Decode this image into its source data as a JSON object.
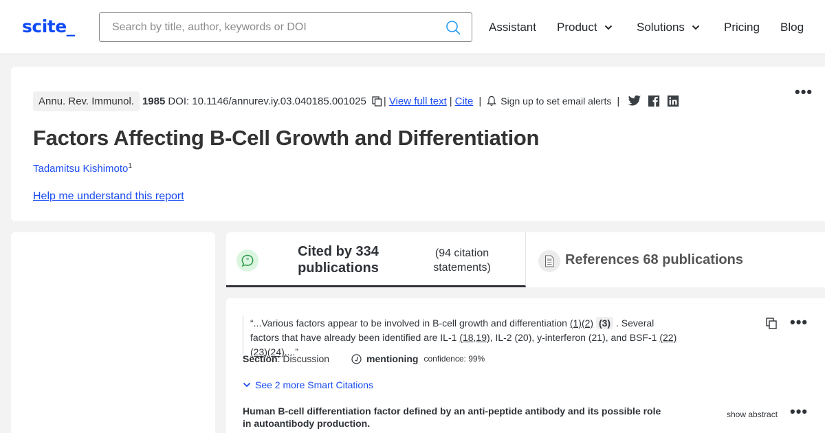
{
  "header": {
    "logo": "scite_",
    "search_placeholder": "Search by title, author, keywords or DOI",
    "search_value": "",
    "nav": [
      {
        "label": "Assistant",
        "has_dropdown": false
      },
      {
        "label": "Product",
        "has_dropdown": true
      },
      {
        "label": "Solutions",
        "has_dropdown": true
      },
      {
        "label": "Pricing",
        "has_dropdown": false
      },
      {
        "label": "Blog",
        "has_dropdown": false
      }
    ]
  },
  "paper": {
    "journal": "Annu. Rev. Immunol.",
    "year": "1985",
    "doi_label": "DOI:",
    "doi": "10.1146/annurev.iy.03.040185.001025",
    "separator": "|",
    "view_full_text": "View full text",
    "cite": "Cite",
    "email_alerts": "Sign up to set email alerts",
    "social": [
      "twitter-icon",
      "facebook-icon",
      "linkedin-icon"
    ],
    "more_menu": "•••",
    "title": "Factors Affecting B-Cell Growth and Differentiation",
    "author": "Tadamitsu Kishimoto",
    "author_affiliation": "1",
    "help_link": "Help me understand this report"
  },
  "tabs": {
    "cited": {
      "title": "Cited by 334 publications",
      "subtitle": "(94 citation statements)",
      "active": true
    },
    "references": {
      "title": "References 68 publications",
      "active": false
    }
  },
  "citation": {
    "quote_parts": [
      {
        "text": "“...Various factors appear to be involved in B-cell growth and differentiation ",
        "type": "text"
      },
      {
        "text": "(1)(2)",
        "type": "ref"
      },
      {
        "text": " ",
        "type": "text"
      },
      {
        "text": "(3)",
        "type": "highlight"
      },
      {
        "text": " . Several factors that have already been identified are IL-1 ",
        "type": "text"
      },
      {
        "text": "(18,19)",
        "type": "ref"
      },
      {
        "text": ", IL-2 (20), y-interferon (21), and BSF-1 ",
        "type": "text"
      },
      {
        "text": "(22)(23)(24)",
        "type": "ref"
      },
      {
        "text": "....”",
        "type": "text"
      }
    ],
    "section_label": "Section",
    "section_value": ": Discussion",
    "classification": "mentioning",
    "confidence": "confidence: 99%",
    "more_smart_citations": "See 2 more Smart Citations",
    "publication_title": "Human B-cell differentiation factor defined by an anti-peptide antibody and its possible role in autoantibody production.",
    "show_abstract": "show abstract",
    "more_menu": "•••"
  }
}
